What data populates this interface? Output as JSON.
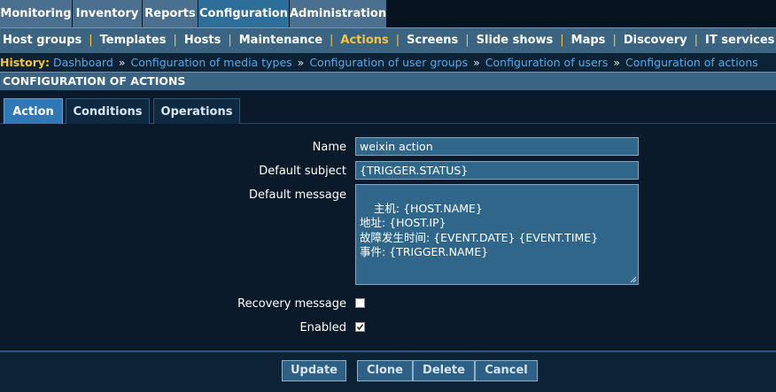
{
  "top_menu": {
    "items": [
      "Monitoring",
      "Inventory",
      "Reports",
      "Configuration",
      "Administration"
    ],
    "active": "Configuration"
  },
  "sub_menu": {
    "items": [
      "Host groups",
      "Templates",
      "Hosts",
      "Maintenance",
      "Actions",
      "Screens",
      "Slide shows",
      "Maps",
      "Discovery",
      "IT services"
    ],
    "active": "Actions",
    "separator": "|"
  },
  "history": {
    "label": "History:",
    "links": [
      "Dashboard",
      "Configuration of media types",
      "Configuration of user groups",
      "Configuration of users",
      "Configuration of actions"
    ],
    "separator": "»"
  },
  "page_title": "CONFIGURATION OF ACTIONS",
  "form_tabs": {
    "items": [
      "Action",
      "Conditions",
      "Operations"
    ],
    "active": "Action"
  },
  "form": {
    "name_label": "Name",
    "name_value": "weixin action",
    "subject_label": "Default subject",
    "subject_value": "{TRIGGER.STATUS}",
    "message_label": "Default message",
    "message_value": "主机: {HOST.NAME}\n地址: {HOST.IP}\n故障发生时间: {EVENT.DATE} {EVENT.TIME}\n事件: {TRIGGER.NAME}",
    "recovery_label": "Recovery message",
    "recovery_checked": false,
    "enabled_label": "Enabled",
    "enabled_checked": true
  },
  "buttons": {
    "update": "Update",
    "clone": "Clone",
    "delete": "Delete",
    "cancel": "Cancel"
  },
  "colors": {
    "active_menu_text": "#f5c542",
    "link": "#5aa9e6",
    "field_bg": "#2f6689",
    "active_tab": "#2f78b5"
  }
}
